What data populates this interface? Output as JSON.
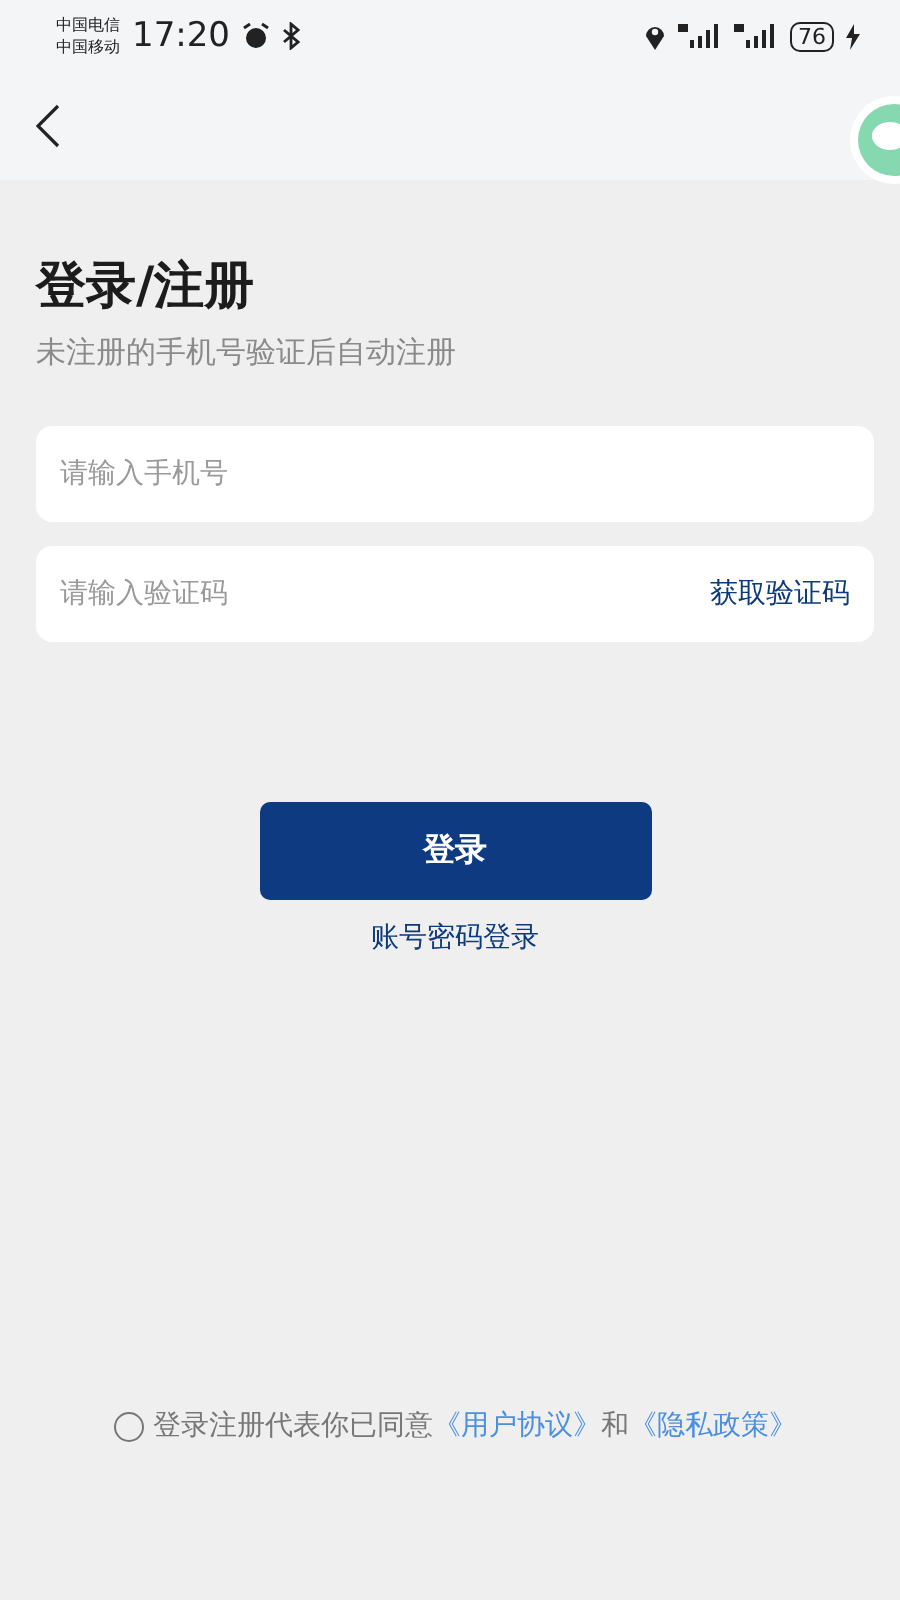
{
  "status_bar": {
    "carriers": [
      "中国电信",
      "中国移动"
    ],
    "time": "17:20",
    "battery": "76"
  },
  "title": "登录/注册",
  "subtitle": "未注册的手机号验证后自动注册",
  "phone_field": {
    "placeholder": "请输入手机号"
  },
  "code_field": {
    "placeholder": "请输入验证码",
    "action": "获取验证码"
  },
  "login_button": "登录",
  "password_login_link": "账号密码登录",
  "agreement": {
    "checked": false,
    "text": "登录注册代表你已同意",
    "terms_link": "《用户协议》",
    "joiner": "和",
    "privacy_link": "《隐私政策》"
  }
}
